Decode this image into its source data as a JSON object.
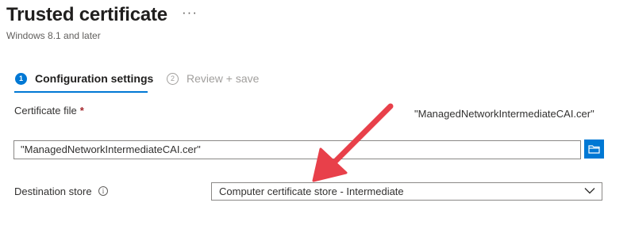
{
  "header": {
    "title": "Trusted certificate",
    "more_label": "···",
    "subtitle": "Windows 8.1 and later"
  },
  "steps": [
    {
      "number": "1",
      "label": "Configuration settings",
      "active": true
    },
    {
      "number": "2",
      "label": "Review + save",
      "active": false
    }
  ],
  "form": {
    "certificate_file": {
      "label": "Certificate file",
      "required_marker": "*",
      "selected_file": "\"ManagedNetworkIntermediateCAI.cer\"",
      "input_value": "\"ManagedNetworkIntermediateCAI.cer\""
    },
    "destination_store": {
      "label": "Destination store",
      "info_icon": "i",
      "selected": "Computer certificate store - Intermediate"
    }
  },
  "colors": {
    "accent": "#0078d4",
    "annotation_arrow": "#e8404a"
  },
  "icons": [
    "more-icon",
    "folder-icon",
    "info-icon",
    "chevron-down-icon"
  ]
}
